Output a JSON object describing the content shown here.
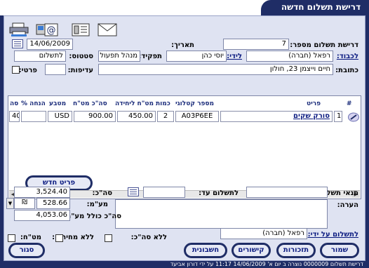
{
  "window": {
    "title": "דרישת תשלום חדשה"
  },
  "toolbar": {
    "icons": [
      "printer-icon",
      "email-at-icon",
      "fax-icon",
      "envelope-icon"
    ]
  },
  "header": {
    "request_label": "דרישת תשלום מספר:",
    "request_value": "7",
    "date_label": "תאריך:",
    "date_value": "14/06/2009",
    "to_label": "לכבוד:",
    "to_value": "רפאל (חברה)",
    "attn_label": "לידי:",
    "attn_value": "יוסי כהן",
    "role_label": "תפקיד:",
    "role_value": "מנהל תפעול",
    "status_label": "סטטוס:",
    "status_value": "לתשלום",
    "address_label": "כתובת:",
    "address_value": "חיים וייצמן 23, חולון",
    "priority_label": "עדיפות:",
    "private_label": "פרטי:"
  },
  "grid": {
    "columns": {
      "num": "#",
      "item": "פריט",
      "catalog": "מספר קטלוגי",
      "qty": "כמות",
      "unit_price": "מט\"ח ליחידה",
      "total_fx": "סה\"כ מט\"ח",
      "currency": "מטבע",
      "discount": "% הנחה",
      "total": "סה"
    },
    "rows": [
      {
        "num": "1",
        "item": "סורק שקים",
        "catalog": "A03P6EE",
        "qty": "2",
        "unit_price": "450.00",
        "total_fx": "900.00",
        "currency": "USD",
        "discount": "",
        "total": "40"
      }
    ],
    "new_item_button": "פריט חדש"
  },
  "totals": {
    "subtotal_label": "סה\"כ:",
    "subtotal_value": "3,524.40",
    "vat_label": "מע\"מ:",
    "vat_value": "528.66",
    "vat_rate": "₪",
    "grand_label": "סה\"כ כולל מע\"מ:",
    "grand_value": "4,053.06"
  },
  "terms": {
    "payment_terms_label": "תנאי תשלום:",
    "pay_until_label": "לתשלום עד:",
    "note_label": "הערה:"
  },
  "payer": {
    "label": "לתשלום על ידי:",
    "value": "רפאל (חברה)"
  },
  "options": {
    "no_total_label": "ללא סה\"כ:",
    "no_prices_label": "ללא מחירים:",
    "fx_label": "מט\"ח:"
  },
  "buttons": {
    "save": "שמור",
    "reminders": "תזכורות",
    "links": "קישורים",
    "invoice": "חשבונית",
    "close": "סגור"
  },
  "footer": {
    "text": "דרישת תשלום 0000009 נוצרה ב יום א' 14/06/2009 11:17 על ידי דורון אביעד"
  }
}
